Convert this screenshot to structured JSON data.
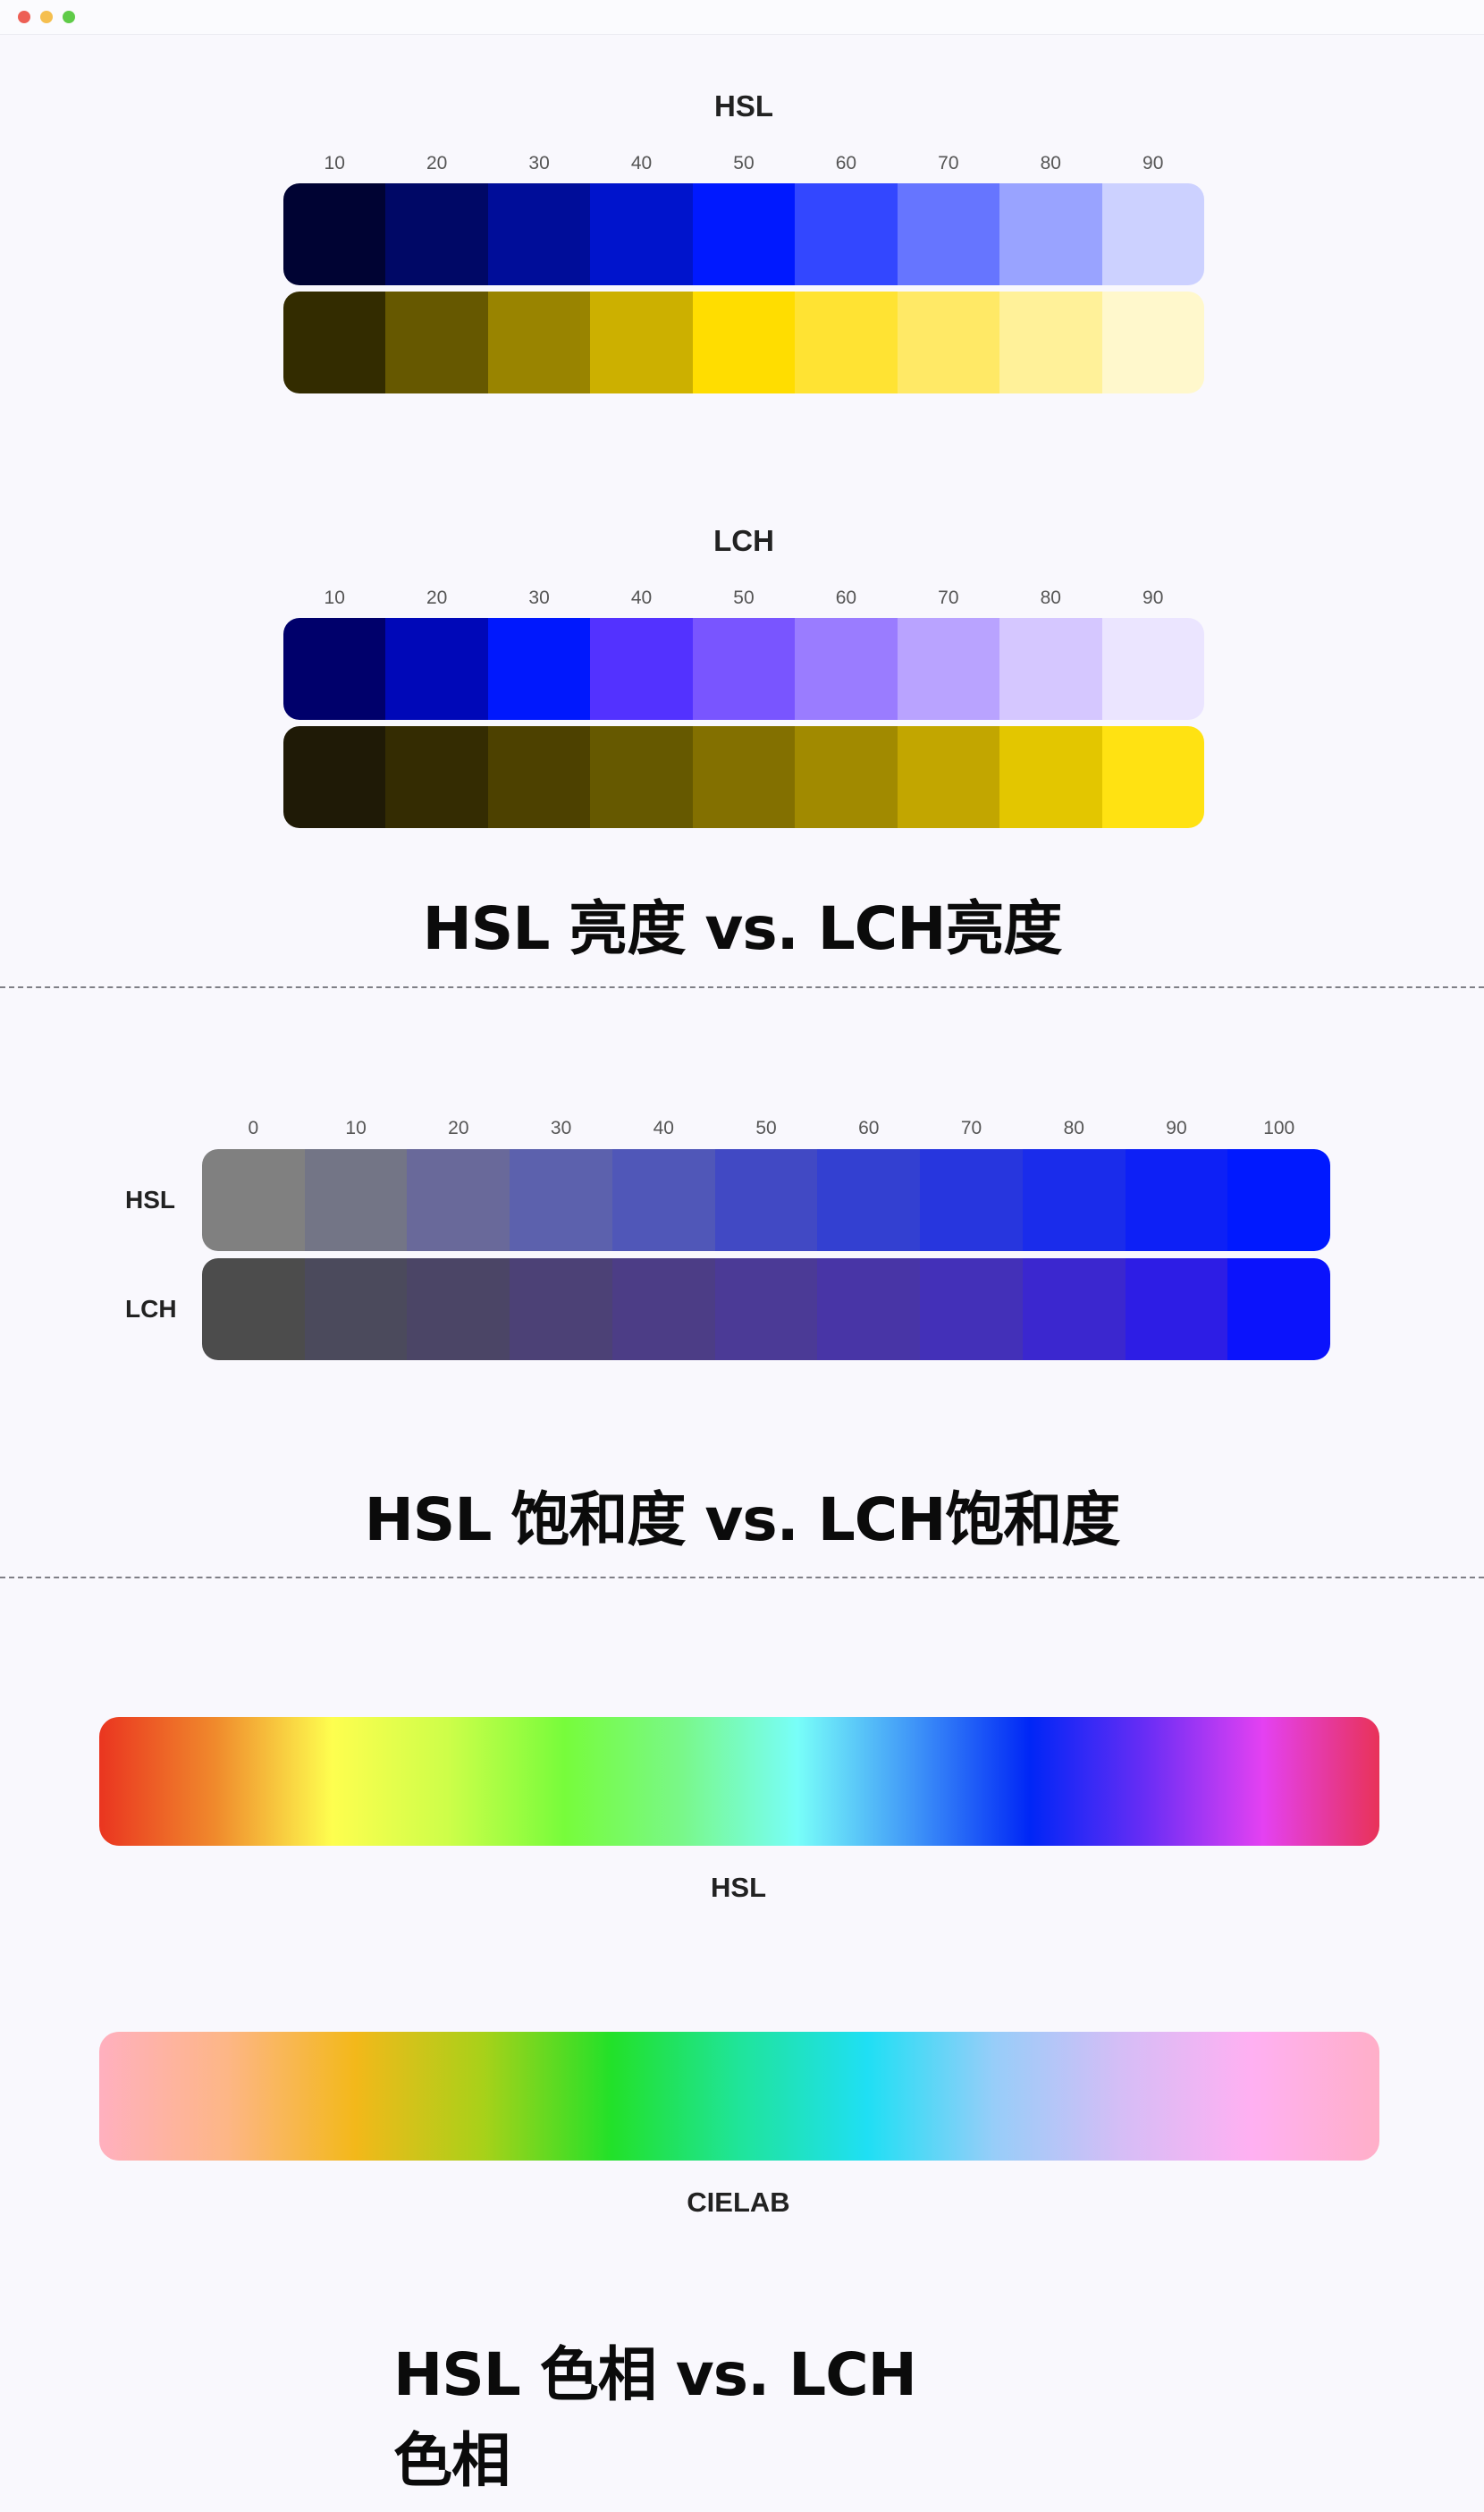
{
  "window": {
    "dots": [
      "#ed5f55",
      "#f5bf4f",
      "#5fcb48"
    ]
  },
  "lightness": {
    "hsl_title": "HSL",
    "lch_title": "LCH",
    "ticks": [
      "10",
      "20",
      "30",
      "40",
      "50",
      "60",
      "70",
      "80",
      "90"
    ],
    "hsl_blue": [
      "#000333",
      "#000866",
      "#000d99",
      "#0014cc",
      "#0019ff",
      "#3347ff",
      "#6675ff",
      "#99a3ff",
      "#ccd1ff"
    ],
    "hsl_yellow": [
      "#332c00",
      "#665800",
      "#998400",
      "#ccb000",
      "#ffdd00",
      "#ffe333",
      "#ffe966",
      "#fff199",
      "#fff8cc"
    ],
    "lch_blue": [
      "#00006b",
      "#0008b8",
      "#0018fd",
      "#5332ff",
      "#7955ff",
      "#9a7cff",
      "#b9a3ff",
      "#d5c7ff",
      "#ebe5ff"
    ],
    "lch_yellow": [
      "#1f1a06",
      "#342c02",
      "#4d4100",
      "#665900",
      "#837000",
      "#a18a00",
      "#c2a600",
      "#e3c600",
      "#ffe212"
    ],
    "heading": "HSL 亮度 vs. LCH亮度"
  },
  "saturation": {
    "ticks": [
      "0",
      "10",
      "20",
      "30",
      "40",
      "50",
      "60",
      "70",
      "80",
      "90",
      "100"
    ],
    "hsl_label": "HSL",
    "lch_label": "LCH",
    "hsl_row": [
      "#808080",
      "#737586",
      "#69699a",
      "#5c61ad",
      "#5057b8",
      "#4149c4",
      "#3340d1",
      "#2736de",
      "#1a2ceb",
      "#0d20f6",
      "#0019ff"
    ],
    "lch_row": [
      "#4c4c4c",
      "#4b4a5c",
      "#4b4566",
      "#4c4176",
      "#4c3d86",
      "#4b3a96",
      "#4835a6",
      "#4330b8",
      "#3b27cf",
      "#2d1de5",
      "#0b13fc"
    ],
    "heading": "HSL 饱和度 vs. LCH饱和度"
  },
  "hue": {
    "hsl_label": "HSL",
    "cielab_label": "CIELAB",
    "hsl_stops": [
      "#ea3520",
      "#f08a2c",
      "#fefe4f",
      "#cdfe49",
      "#77fc3b",
      "#79f889",
      "#78fef9",
      "#3f95f8",
      "#0026f6",
      "#6a2df5",
      "#e441f2",
      "#e83258"
    ],
    "cielab_stops": [
      "#ffb0bf",
      "#fdb686",
      "#f3b81a",
      "#a8d119",
      "#22e129",
      "#1fe49a",
      "#1fdff4",
      "#98cdf9",
      "#d6bdf6",
      "#ffb0f2",
      "#ffafc8"
    ],
    "heading": "HSL 色相 vs. LCH色相"
  }
}
